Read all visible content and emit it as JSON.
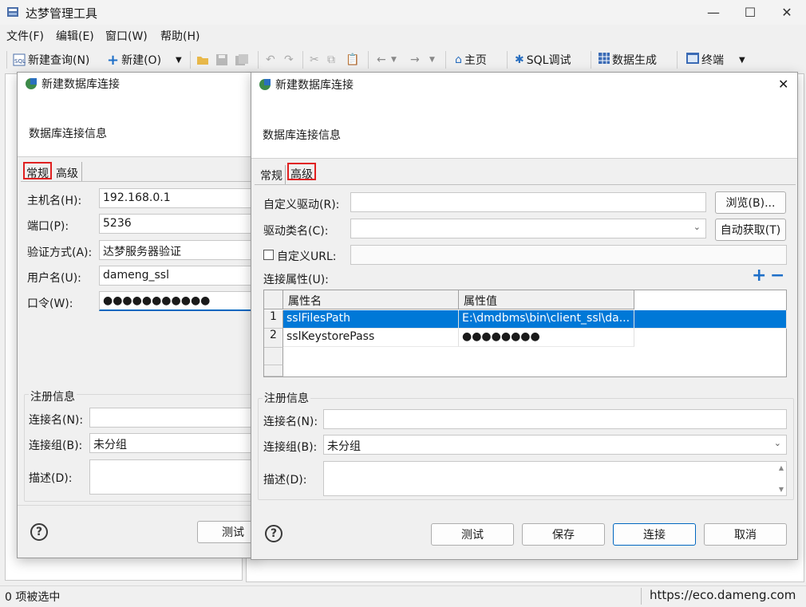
{
  "app": {
    "title": "达梦管理工具"
  },
  "menu": [
    "文件(F)",
    "编辑(E)",
    "窗口(W)",
    "帮助(H)"
  ],
  "toolbar": {
    "new_query": "新建查询(N)",
    "new": "新建(O)",
    "home": "主页",
    "sql_debug": "SQL调试",
    "data_gen": "数据生成",
    "terminal": "终端"
  },
  "status": {
    "left": "0 项被选中",
    "right": "https://eco.dameng.com"
  },
  "back_dialog": {
    "title": "新建数据库连接",
    "banner": "数据库连接信息",
    "tabs": [
      "常规",
      "高级"
    ],
    "fields": [
      {
        "label": "主机名(H):",
        "value": "192.168.0.1"
      },
      {
        "label": "端口(P):",
        "value": "5236"
      },
      {
        "label": "验证方式(A):",
        "value": "达梦服务器验证"
      },
      {
        "label": "用户名(U):",
        "value": "dameng_ssl"
      },
      {
        "label": "口令(W):",
        "value": "●●●●●●●●●●●"
      }
    ],
    "register_title": "注册信息",
    "conn_name_label": "连接名(N):",
    "conn_group_label": "连接组(B):",
    "conn_group_value": "未分组",
    "desc_label": "描述(D):",
    "test_label": "测试"
  },
  "front_dialog": {
    "title": "新建数据库连接",
    "close": "✕",
    "banner": "数据库连接信息",
    "tabs": [
      "常规",
      "高级"
    ],
    "custom_driver_label": "自定义驱动(R):",
    "browse_label": "浏览(B)...",
    "driver_class_label": "驱动类名(C):",
    "auto_fetch_label": "自动获取(T)",
    "custom_url_label": "自定义URL:",
    "conn_props_label": "连接属性(U):",
    "table": {
      "columns": [
        "属性名",
        "属性值"
      ],
      "rows": [
        {
          "num": "1",
          "name": "sslFilesPath",
          "value": "E:\\dmdbms\\bin\\client_ssl\\da..."
        },
        {
          "num": "2",
          "name": "sslKeystorePass",
          "value": "●●●●●●●●"
        }
      ]
    },
    "register_title": "注册信息",
    "conn_name_label": "连接名(N):",
    "conn_group_label": "连接组(B):",
    "conn_group_value": "未分组",
    "desc_label": "描述(D):",
    "buttons": {
      "test": "测试",
      "save": "保存",
      "connect": "连接",
      "cancel": "取消"
    }
  }
}
